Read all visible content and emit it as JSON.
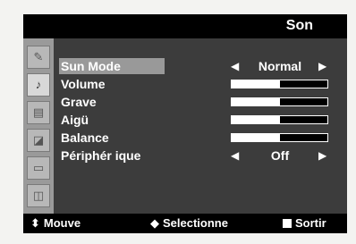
{
  "menu": {
    "title": "Son"
  },
  "sidebar": {
    "icons": [
      "picture-icon",
      "sound-icon",
      "channel-icon",
      "setup-icon",
      "input-icon",
      "function-icon"
    ]
  },
  "items": [
    {
      "label": "Sun Mode",
      "type": "select",
      "value": "Normal",
      "selected": true
    },
    {
      "label": "Volume",
      "type": "slider",
      "level": 0.5
    },
    {
      "label": "Grave",
      "type": "slider",
      "level": 0.5
    },
    {
      "label": "Aigü",
      "type": "slider",
      "level": 0.5
    },
    {
      "label": "Balance",
      "type": "slider",
      "level": 0.5
    },
    {
      "label": "Périphér ique",
      "type": "select",
      "value": "Off",
      "selected": false
    }
  ],
  "footer": {
    "move_label": "Mouve",
    "select_label": "Selectionne",
    "exit_label": "Sortir"
  }
}
